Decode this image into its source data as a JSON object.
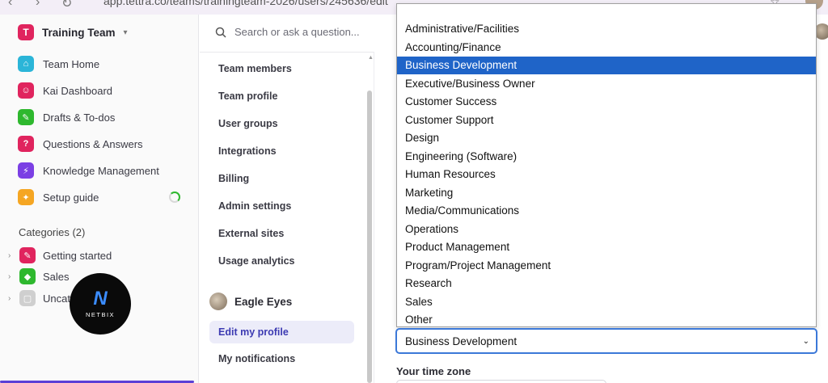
{
  "browser": {
    "url": "app.tettra.co/teams/trainingteam-2026/users/245636/edit"
  },
  "sidebar": {
    "team_name": "Training Team",
    "nav": [
      {
        "label": "Team Home",
        "icon": "home-icon",
        "color": "#2bb5d8"
      },
      {
        "label": "Kai Dashboard",
        "icon": "robot-icon",
        "color": "#e0245e"
      },
      {
        "label": "Drafts & To-dos",
        "icon": "pencil-icon",
        "color": "#2eb82e"
      },
      {
        "label": "Questions & Answers",
        "icon": "question-icon",
        "color": "#e0245e"
      },
      {
        "label": "Knowledge Management",
        "icon": "lightning-icon",
        "color": "#7b3fe4"
      },
      {
        "label": "Setup guide",
        "icon": "wrench-icon",
        "color": "#f5a623"
      }
    ],
    "categories_title": "Categories (2)",
    "categories": [
      {
        "label": "Getting started",
        "icon": "pencil-icon",
        "color": "#e0245e"
      },
      {
        "label": "Sales",
        "icon": "megaphone-icon",
        "color": "#2eb82e"
      },
      {
        "label": "Uncate",
        "icon": "folder-icon",
        "color": "#cfcfcf"
      }
    ],
    "watermark": "NETBIX"
  },
  "search": {
    "placeholder": "Search or ask a question..."
  },
  "settings": {
    "items": [
      "Team members",
      "Team profile",
      "User groups",
      "Integrations",
      "Billing",
      "Admin settings",
      "External sites",
      "Usage analytics"
    ],
    "user_name": "Eagle Eyes",
    "edit_profile": "Edit my profile",
    "my_notifications": "My notifications"
  },
  "role_select": {
    "selected": "Business Development",
    "options": [
      "Administrative/Facilities",
      "Accounting/Finance",
      "Business Development",
      "Executive/Business Owner",
      "Customer Success",
      "Customer Support",
      "Design",
      "Engineering (Software)",
      "Human Resources",
      "Marketing",
      "Media/Communications",
      "Operations",
      "Product Management",
      "Program/Project Management",
      "Research",
      "Sales",
      "Other"
    ],
    "selected_index": 2
  },
  "timezone": {
    "label": "Your time zone"
  }
}
